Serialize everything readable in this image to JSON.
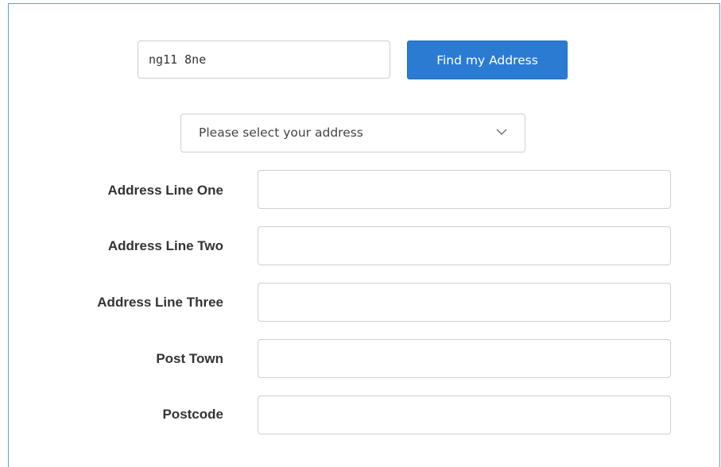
{
  "postcode_search": {
    "value": "ng11 8ne",
    "button_label": "Find my Address"
  },
  "address_select": {
    "selected": "Please select your address"
  },
  "fields": [
    {
      "label": "Address Line One",
      "value": ""
    },
    {
      "label": "Address Line Two",
      "value": ""
    },
    {
      "label": "Address Line Three",
      "value": ""
    },
    {
      "label": "Post Town",
      "value": ""
    },
    {
      "label": "Postcode",
      "value": ""
    }
  ],
  "colors": {
    "frame_border": "#5aa3da",
    "primary_button": "#2b7bd3",
    "input_border": "#cfcfcf",
    "label_text": "#333333"
  }
}
